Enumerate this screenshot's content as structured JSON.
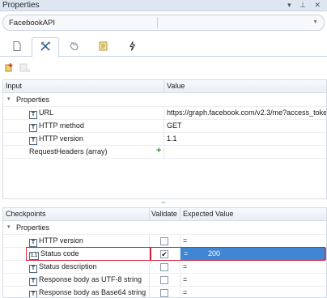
{
  "panel": {
    "title": "Properties",
    "controls": "▾ ⊥ ✕"
  },
  "object_selector": {
    "value": "FacebookAPI"
  },
  "tabs": [
    {
      "icon": "page-icon"
    },
    {
      "icon": "properties-icon"
    },
    {
      "icon": "hand-icon"
    },
    {
      "icon": "document-icon"
    },
    {
      "icon": "lightning-icon"
    }
  ],
  "input_grid": {
    "col_input": "Input",
    "col_value": "Value",
    "group": "Properties",
    "rows": [
      {
        "badge": "T",
        "name": "URL",
        "value": "https://graph.facebook.com/v2.3/me?access_toke"
      },
      {
        "badge": "T",
        "name": "HTTP method",
        "value": "GET"
      },
      {
        "badge": "T",
        "name": "HTTP version",
        "value": "1.1"
      },
      {
        "badge": "",
        "name": "RequestHeaders   (array)",
        "value": ""
      }
    ]
  },
  "checkpoints_grid": {
    "col_checkpoints": "Checkpoints",
    "col_validate": "Validate",
    "col_expected": "Expected Value",
    "group": "Properties",
    "rows": [
      {
        "badge": "T",
        "name": "HTTP version",
        "checked": false,
        "op": "=",
        "expected": ""
      },
      {
        "badge": "1.1",
        "name": "Status code",
        "checked": true,
        "op": "=",
        "expected": "200"
      },
      {
        "badge": "T",
        "name": "Status description",
        "checked": false,
        "op": "=",
        "expected": ""
      },
      {
        "badge": "T",
        "name": "Response body as UTF-8 string",
        "checked": false,
        "op": "=",
        "expected": ""
      },
      {
        "badge": "T",
        "name": "Response body as Base64 string",
        "checked": false,
        "op": "=",
        "expected": ""
      }
    ]
  },
  "colors": {
    "selection": "#3f86d4",
    "highlight_border": "#d1263a",
    "add_icon": "#2a9d2a"
  }
}
